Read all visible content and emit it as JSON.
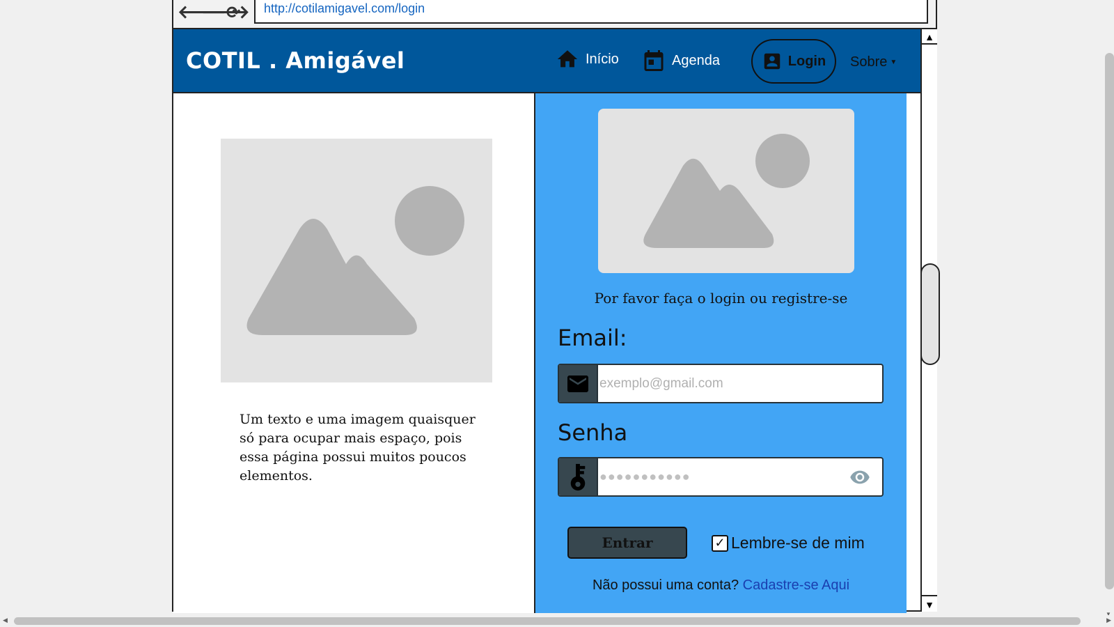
{
  "browser": {
    "url": "http://cotilamigavel.com/login",
    "back_icon": "arrow-left-icon",
    "forward_icon": "arrow-right-icon",
    "reload_icon": "reload-icon"
  },
  "header": {
    "logo": "COTIL . Amigável",
    "nav": {
      "inicio": "Início",
      "agenda": "Agenda",
      "login": "Login",
      "sobre": "Sobre"
    }
  },
  "left": {
    "text": "Um texto e uma imagem quaisquer só para ocupar mais espaço, pois essa página possui muitos poucos elementos."
  },
  "login": {
    "prompt": "Por favor faça o login ou registre-se",
    "email_label": "Email:",
    "email_placeholder": "exemplo@gmail.com",
    "password_label": "Senha",
    "password_placeholder": "●●●●●●●●●●●",
    "submit": "Entrar",
    "remember": "Lembre-se de mim",
    "remember_checked": true,
    "no_account": "Não possui uma conta?",
    "register_link": "Cadastre-se Aqui"
  },
  "colors": {
    "header": "#00579b",
    "login_panel": "#42a5f5",
    "addon": "#37474f",
    "link": "#1a3fb0"
  }
}
